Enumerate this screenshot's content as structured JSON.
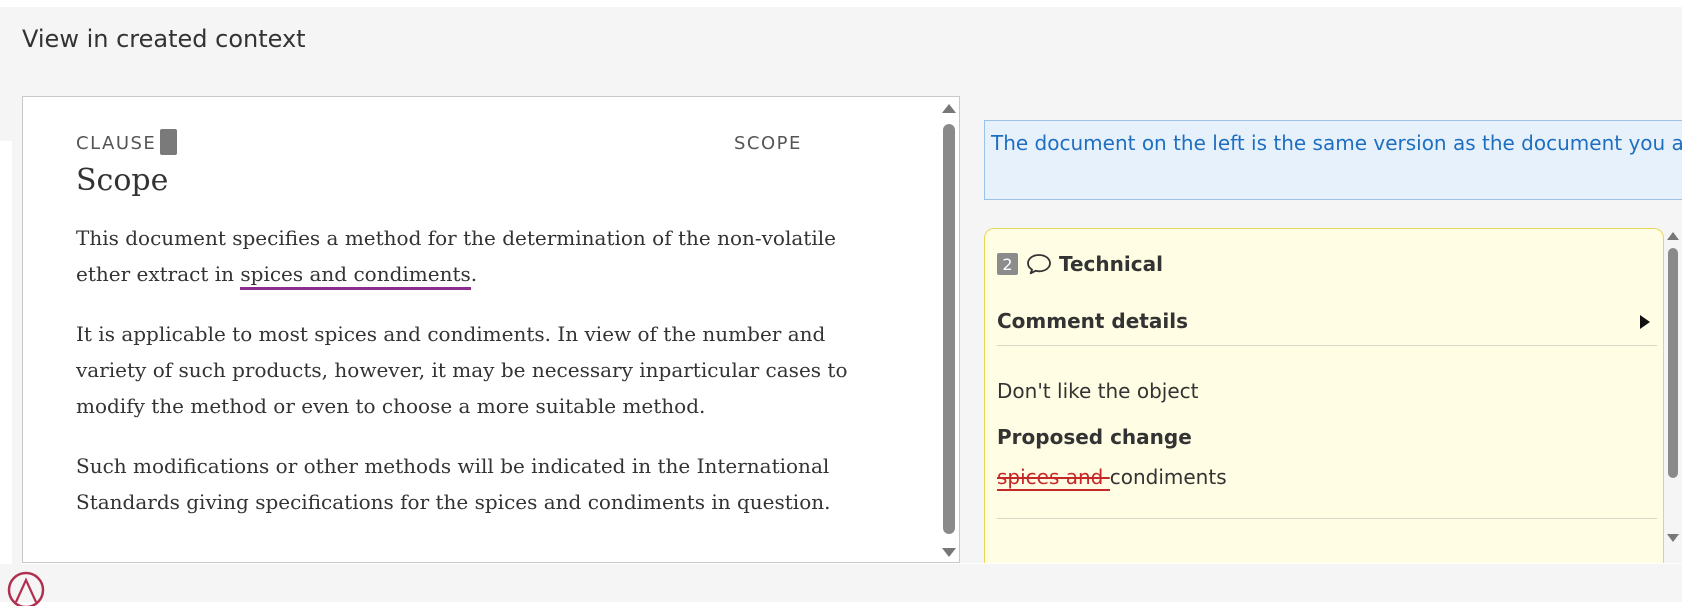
{
  "page": {
    "title": "View in created context"
  },
  "document": {
    "clause_label": "CLAUSE",
    "scope_label": "SCOPE",
    "heading": "Scope",
    "paragraphs": {
      "p1_before": "This document specifies a method for the determination of the non-volatile ether extract in ",
      "p1_highlight": "spices and condiments",
      "p1_after": ".",
      "p2": "It is applicable to most spices and condiments. In view of the number and variety of such products, however, it may be necessary inparticular cases to modify the method or even to choose a more suitable method.",
      "p3": "Such modifications or other methods will be indicated in the International Standards giving specifications for the spices and condiments in question."
    },
    "highlight_color": "#8b2c8f"
  },
  "info": {
    "message": "The document on the left is the same version as the document you are currently working on."
  },
  "comment": {
    "number": "2",
    "type_icon": "speech-bubble-icon",
    "type": "Technical",
    "details_label": "Comment details",
    "details_toggle_icon": "caret-right-icon",
    "observation": "Don't like the object",
    "proposed_label": "Proposed change",
    "proposed_deleted": "spices and ",
    "proposed_kept": "condiments",
    "card_color": "#fffde3",
    "deleted_color": "#c62828"
  },
  "colors": {
    "info_text": "#1f6fc0",
    "info_background": "#e7f1fc"
  }
}
